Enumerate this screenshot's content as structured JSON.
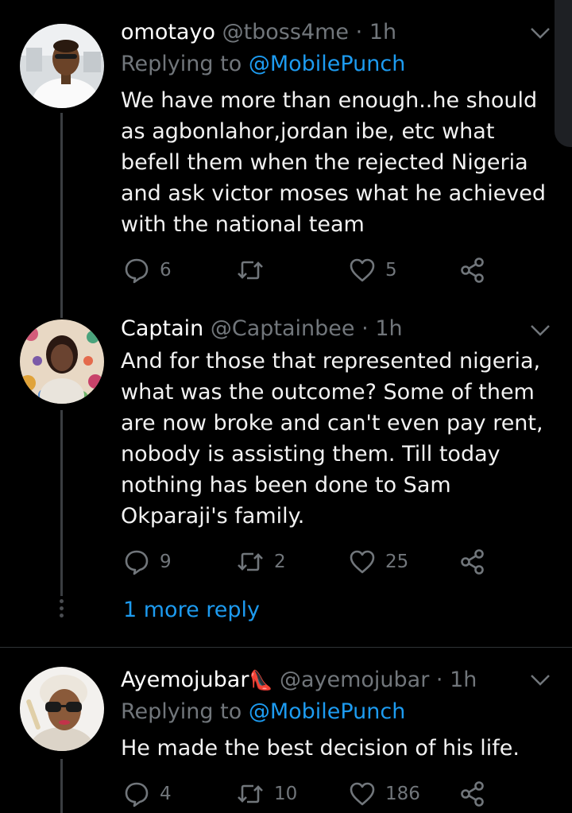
{
  "accent_color": "#1d9bf0",
  "background_color": "#000000",
  "tweets": [
    {
      "display_name": "omotayo",
      "handle": "@tboss4me",
      "separator": "·",
      "time": "1h",
      "replying_prefix": "Replying to",
      "replying_to": "@MobilePunch",
      "text": "We have more than enough..he should as agbonlahor,jordan ibe, etc what befell them when the rejected Nigeria and ask victor moses what he achieved with the national team",
      "reply_count": "6",
      "retweet_count": "",
      "like_count": "5"
    },
    {
      "display_name": "Captain",
      "handle": "@Captainbee",
      "separator": "·",
      "time": "1h",
      "text": "And for those that represented nigeria, what was the outcome? Some of them are now broke and can't even pay rent, nobody is assisting them.  Till today nothing has been done to Sam Okparaji's family.",
      "reply_count": "9",
      "retweet_count": "2",
      "like_count": "25",
      "more_replies_label": "1 more reply"
    },
    {
      "display_name": "Ayemojubar",
      "name_emoji": "👠",
      "handle": "@ayemojubar",
      "separator": "·",
      "time": "1h",
      "replying_prefix": "Replying to",
      "replying_to": "@MobilePunch",
      "text": "He made the best decision of his life.",
      "reply_count": "4",
      "retweet_count": "10",
      "like_count": "186"
    }
  ]
}
